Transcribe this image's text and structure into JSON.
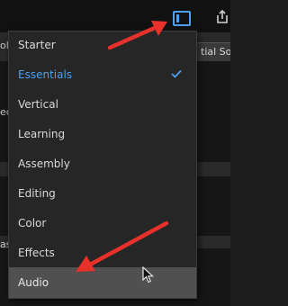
{
  "background": {
    "left_labels": [
      "olo",
      "ec",
      "as"
    ],
    "tab_label": "tial Sou"
  },
  "toolbar": {
    "panel_icon": "panel-layout-icon",
    "export_icon": "export-share-icon"
  },
  "menu": {
    "items": [
      {
        "label": "Starter"
      },
      {
        "label": "Essentials",
        "selected": true
      },
      {
        "label": "Vertical"
      },
      {
        "label": "Learning"
      },
      {
        "label": "Assembly"
      },
      {
        "label": "Editing"
      },
      {
        "label": "Color"
      },
      {
        "label": "Effects"
      },
      {
        "label": "Audio",
        "hovered": true
      }
    ],
    "check_icon": "checkmark-icon"
  },
  "annotations": {
    "arrow_color": "#e8312a"
  },
  "colors": {
    "accent": "#4ea0f0",
    "menu_bg": "#262626",
    "hover_bg": "#505050"
  }
}
